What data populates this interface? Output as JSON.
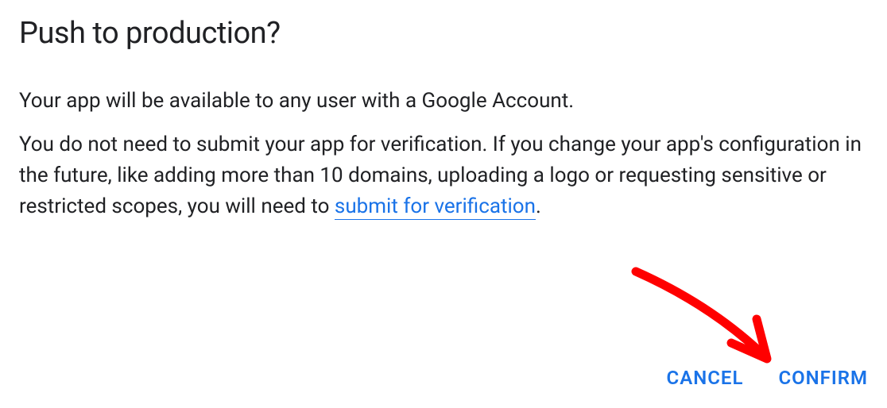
{
  "dialog": {
    "title": "Push to production?",
    "paragraph1": "Your app will be available to any user with a Google Account.",
    "paragraph2_before_link": "You do not need to submit your app for verification. If you change your app's configuration in the future, like adding more than 10 domains, uploading a logo or requesting sensitive or restricted scopes, you will need to ",
    "link_text": "submit for verification",
    "paragraph2_after_link": ".",
    "cancel_label": "CANCEL",
    "confirm_label": "CONFIRM"
  },
  "colors": {
    "text": "#202124",
    "accent": "#1a73e8",
    "annotation": "#ff0000"
  }
}
